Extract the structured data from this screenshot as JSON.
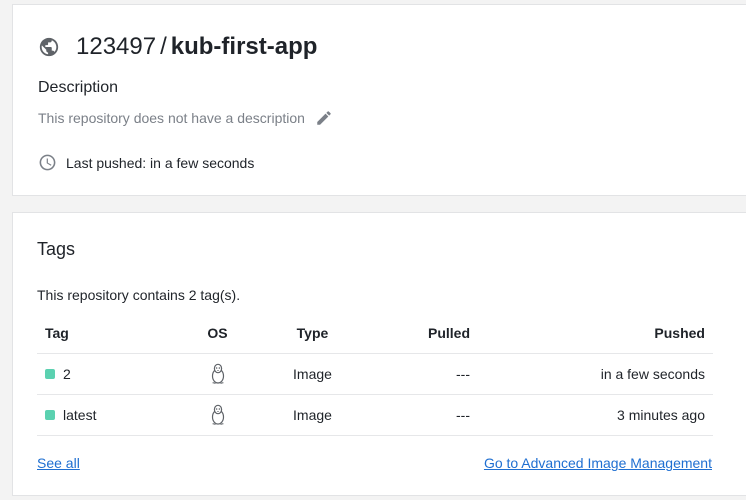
{
  "repo": {
    "namespace": "123497",
    "separator": "/",
    "name": "kub-first-app",
    "visibility_icon": "globe-icon"
  },
  "description": {
    "label": "Description",
    "text": "This repository does not have a description",
    "edit_icon": "pencil-icon"
  },
  "last_pushed": {
    "text": "Last pushed: in a few seconds",
    "icon": "clock-icon"
  },
  "tags": {
    "title": "Tags",
    "count_text": "This repository contains 2 tag(s).",
    "columns": [
      "Tag",
      "OS",
      "Type",
      "Pulled",
      "Pushed"
    ],
    "rows": [
      {
        "tag": "2",
        "os_icon": "linux-icon",
        "type": "Image",
        "pulled": "---",
        "pushed": "in a few seconds"
      },
      {
        "tag": "latest",
        "os_icon": "linux-icon",
        "type": "Image",
        "pulled": "---",
        "pushed": "3 minutes ago"
      }
    ],
    "see_all": "See all",
    "advanced_link": "Go to Advanced Image Management"
  },
  "colors": {
    "tag_dot": "#5bd1b0",
    "link": "#1f6fd1",
    "muted_text": "#7b8088"
  }
}
